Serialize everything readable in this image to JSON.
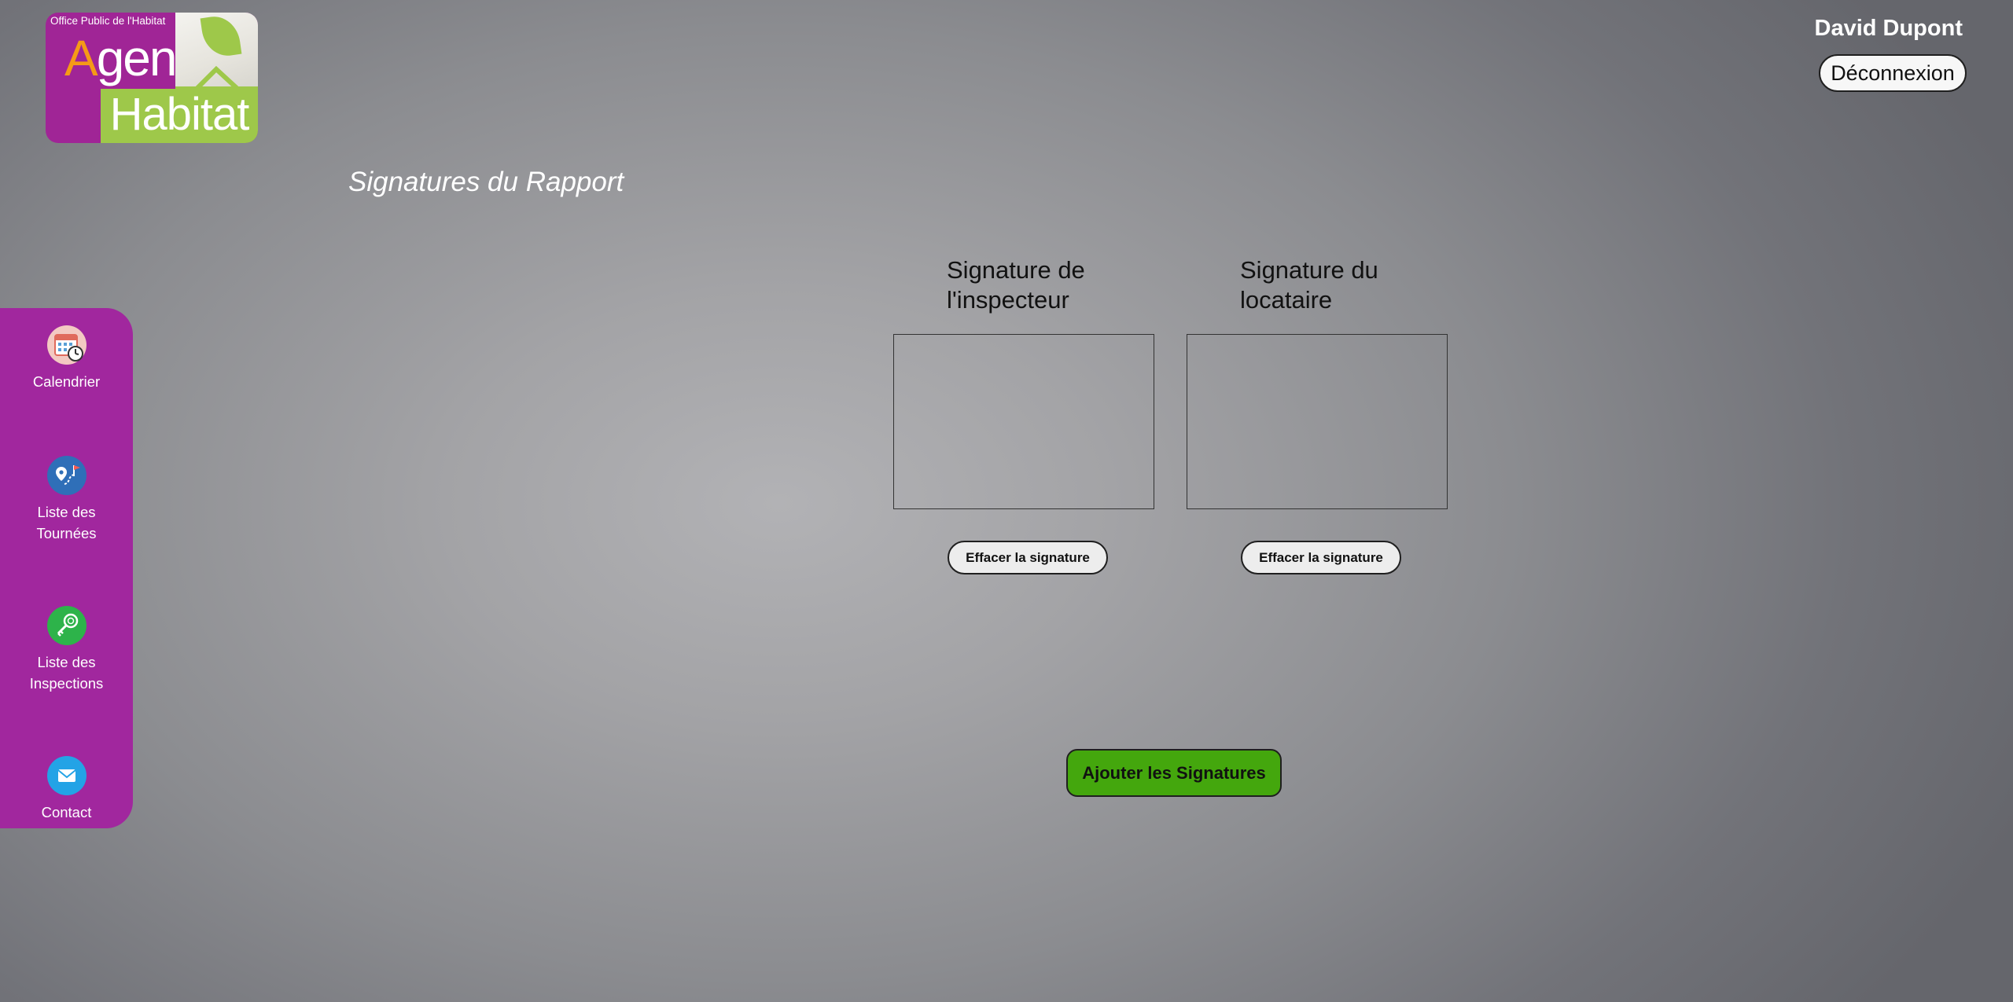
{
  "logo": {
    "tagline": "Office Public de l'Habitat",
    "word_agen_first": "A",
    "word_agen_rest": "gen",
    "word_habitat": "Habitat",
    "colors": {
      "purple": "#a02596",
      "orange": "#f59a17",
      "green": "#9ec84a"
    }
  },
  "header": {
    "user_name": "David Dupont",
    "logout_label": "Déconnexion"
  },
  "page": {
    "title": "Signatures du Rapport"
  },
  "sidebar": {
    "color": "#a1279e",
    "items": [
      {
        "label": "Calendrier",
        "icon": "calendar-icon"
      },
      {
        "label": "Liste des Tournées",
        "icon": "route-map-icon"
      },
      {
        "label": "Liste des Inspections",
        "icon": "inspection-key-icon"
      },
      {
        "label": "Contact",
        "icon": "mail-icon"
      }
    ]
  },
  "signatures": {
    "inspector": {
      "heading": "Signature de l'inspecteur",
      "clear_label": "Effacer la signature"
    },
    "tenant": {
      "heading": "Signature du locataire",
      "clear_label": "Effacer la signature"
    },
    "submit_label": "Ajouter les Signatures",
    "submit_color": "#44a70d"
  }
}
